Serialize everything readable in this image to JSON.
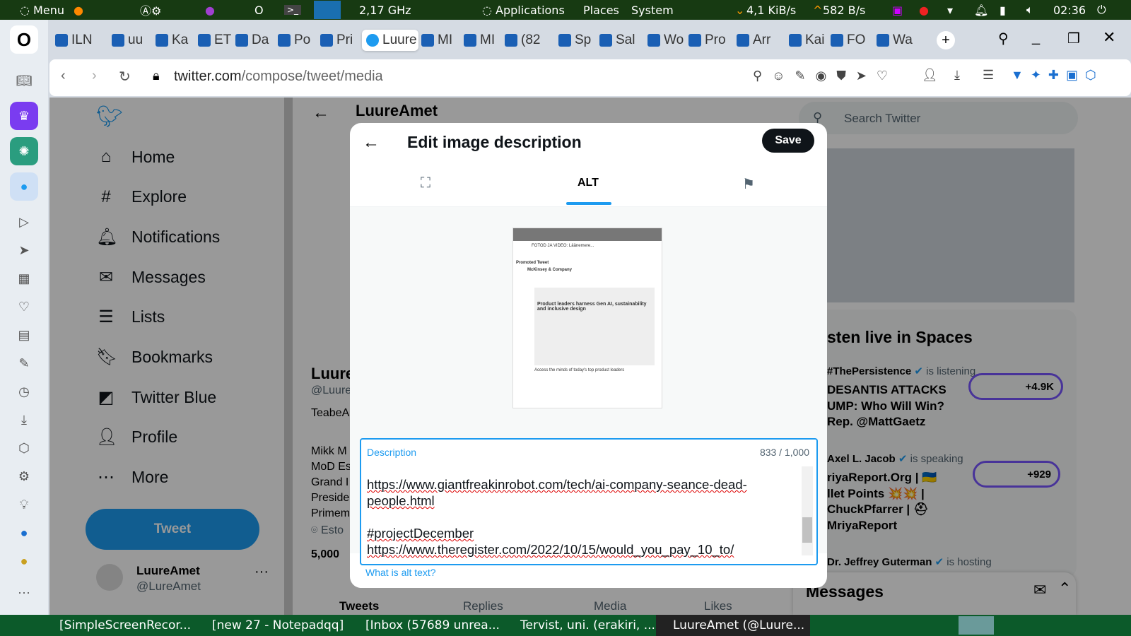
{
  "top_panel": {
    "menu": "Menu",
    "cpu": "2,17 GHz",
    "applications": "Applications",
    "places": "Places",
    "system": "System",
    "net": "4,1 KiB/s",
    "net_up": "582 B/s",
    "clock": "02:36"
  },
  "tabs": [
    "ILN",
    "uu",
    "Ka",
    "ET",
    "Da",
    "Po",
    "Pri",
    "Luure",
    "MI",
    "MI",
    "(82",
    "Sp",
    "Sal",
    "Wo",
    "Pro",
    "Arr",
    "Kai",
    "FO",
    "Wa"
  ],
  "tab_new": "+",
  "address": {
    "domain": "twitter.com",
    "path": "/compose/tweet/media"
  },
  "twitter": {
    "nav": [
      "Home",
      "Explore",
      "Notifications",
      "Messages",
      "Lists",
      "Bookmarks",
      "Twitter Blue",
      "Profile",
      "More"
    ],
    "tweet_button": "Tweet",
    "account_name": "LuureAmet",
    "account_handle": "@LureAmet",
    "header_name": "LuureAmet",
    "profile": {
      "name": "Luure",
      "handle": "@Luure",
      "bio1": "TeabeA",
      "bio_lines": [
        "Mikk M",
        "MoD Es",
        "Grand I",
        "Preside",
        "Primem"
      ],
      "location": "Esto",
      "followers": "5,000"
    },
    "profile_tabs": [
      "Tweets",
      "Replies",
      "Media",
      "Likes"
    ],
    "search_placeholder": "Search Twitter",
    "spaces_title": "sten live in Spaces",
    "spaces": [
      {
        "host": "#ThePersistence",
        "status": "is listening",
        "title": [
          "DESANTIS ATTACKS",
          "UMP: Who Will Win?",
          "Rep. @MattGaetz"
        ],
        "count": "+4.9K"
      },
      {
        "host": "Axel L. Jacob",
        "status": "is speaking",
        "title": [
          "riyaReport.Org | 🇺🇦",
          "llet Points 💥💥 |",
          "ChuckPfarrer | ⛑",
          "MriyaReport"
        ],
        "count": "+929"
      },
      {
        "host": "Dr. Jeffrey Guterman",
        "status": "is hosting",
        "title": [],
        "count": ""
      }
    ],
    "messages_title": "Messages"
  },
  "modal": {
    "title": "Edit image description",
    "save": "Save",
    "tab_alt": "ALT",
    "field_label": "Description",
    "counter": "833 / 1,000",
    "text_lines": [
      "https://www.giantfreakinrobot.com/tech/ai-company-seance-dead-",
      "people.html",
      "",
      "#projectDecember",
      "https://www.theregister.com/2022/10/15/would_you_pay_10_to/"
    ],
    "help_link": "What is alt text?",
    "preview": {
      "caption": "FOTOD JA VIDEO: Läänemere...",
      "promoted": "Promoted Tweet",
      "advertiser": "McKinsey & Company",
      "ad_headline": "Product leaders harness Gen AI, sustainability and inclusive design",
      "ad_footer": "Access the minds of today's top product leaders"
    }
  },
  "taskbar": [
    "[SimpleScreenRecor...",
    "[new 27 - Notepadqq]",
    "[Inbox (57689 unrea...",
    "Tervist, uni. (erakiri, ...",
    "LuureAmet (@Luure..."
  ]
}
